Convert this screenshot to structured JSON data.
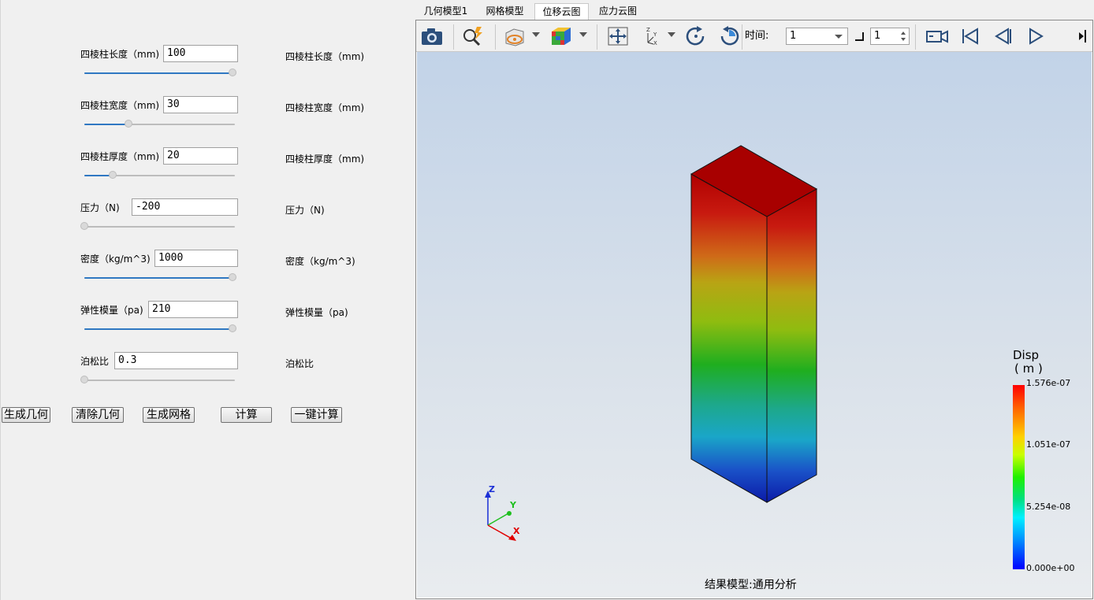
{
  "parameters": [
    {
      "label": "四棱柱长度（mm)",
      "value": "100",
      "echo": "四棱柱长度（mm)",
      "level": 1.0
    },
    {
      "label": "四棱柱宽度（mm)",
      "value": "30",
      "echo": "四棱柱宽度（mm)",
      "level": 0.3
    },
    {
      "label": "四棱柱厚度（mm)",
      "value": "20",
      "echo": "四棱柱厚度（mm)",
      "level": 0.19
    },
    {
      "label": "压力（N)",
      "value": "-200",
      "echo": "压力（N)",
      "level": 0.0
    },
    {
      "label": "密度（kg/m^3)",
      "value": "1000",
      "echo": "密度（kg/m^3)",
      "level": 1.0
    },
    {
      "label": "弹性模量（pa)",
      "value": "210",
      "echo": "弹性模量（pa)",
      "level": 1.0
    },
    {
      "label": "泊松比",
      "value": "0.3",
      "echo": "泊松比",
      "level": 0.0
    }
  ],
  "buttons": [
    "生成几何",
    "清除几何",
    "生成网格",
    "计算",
    "一键计算"
  ],
  "tabs": [
    {
      "label": "几何模型1",
      "active": false
    },
    {
      "label": "网格模型",
      "active": false
    },
    {
      "label": "位移云图",
      "active": true
    },
    {
      "label": "应力云图",
      "active": false
    }
  ],
  "toolbar": {
    "time_label": "时间:",
    "time_value": "1",
    "step_value": "1",
    "icons": [
      "camera-icon",
      "zoom-fit-icon",
      "visibility-icon",
      "color-cube-icon",
      "pan-icon",
      "axes-icon",
      "rotate-cw-icon",
      "rotate-ccw-icon",
      "record-icon",
      "first-frame-icon",
      "prev-frame-icon",
      "play-icon",
      "more-icon"
    ]
  },
  "viewport": {
    "caption": "结果模型:通用分析",
    "colorbar": {
      "title": "Disp",
      "unit": "( m )",
      "ticks": [
        "1.576e-07",
        "1.051e-07",
        "5.254e-08",
        "0.000e+00"
      ]
    },
    "triad": {
      "x": "X",
      "y": "Y",
      "z": "Z"
    }
  },
  "colors": {
    "accent": "#2f78c2",
    "axis_x": "#e00000",
    "axis_y": "#1fbf1f",
    "axis_z": "#1a2fd6"
  }
}
